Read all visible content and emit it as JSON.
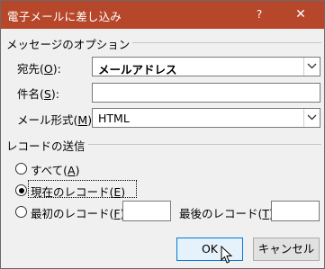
{
  "window": {
    "title": "電子メールに差し込み",
    "help_label": "?",
    "close_label": "✕"
  },
  "options_group": {
    "label": "メッセージのオプション",
    "to": {
      "label": "宛先(",
      "key": "O",
      "suffix": "):",
      "value": "メールアドレス"
    },
    "subject": {
      "label": "件名(",
      "key": "S",
      "suffix": "):",
      "value": ""
    },
    "format": {
      "label": "メール形式(",
      "key": "M",
      "suffix": "):",
      "value": "HTML"
    }
  },
  "records_group": {
    "label": "レコードの送信",
    "all": {
      "label": "すべて(",
      "key": "A",
      "suffix": ")",
      "checked": false
    },
    "current": {
      "label": "現在のレコード(",
      "key": "E",
      "suffix": ")",
      "checked": true
    },
    "range": {
      "from_label": "最初のレコード(",
      "from_key": "F",
      "from_suffix": "):",
      "to_label": "最後のレコード(",
      "to_key": "T",
      "to_suffix": "):",
      "from_value": "",
      "to_value": "",
      "checked": false
    }
  },
  "buttons": {
    "ok": "OK",
    "cancel": "キャンセル"
  },
  "colors": {
    "titlebar": "#b7472a",
    "dialog_bg": "#f0f0f0",
    "focus_border": "#0078d7"
  }
}
